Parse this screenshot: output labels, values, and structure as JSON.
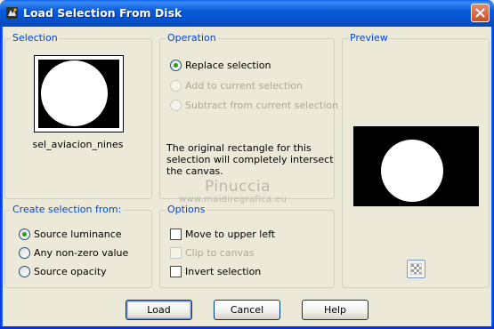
{
  "window": {
    "title": "Load Selection From Disk",
    "title_icon": "paint-shop-icon",
    "close_icon": "close-icon"
  },
  "selection": {
    "group_label": "Selection",
    "thumbnail_name": "sel_aviacion_nines"
  },
  "operation": {
    "group_label": "Operation",
    "options": [
      {
        "label": "Replace selection",
        "checked": true,
        "enabled": true
      },
      {
        "label": "Add to current selection",
        "checked": false,
        "enabled": false
      },
      {
        "label": "Subtract from current selection",
        "checked": false,
        "enabled": false
      }
    ],
    "info_text": "The original rectangle for this selection will completely intersect the canvas."
  },
  "preview": {
    "group_label": "Preview",
    "checker_icon": "transparency-checker-icon"
  },
  "create_from": {
    "group_label": "Create selection from:",
    "options": [
      {
        "label": "Source luminance",
        "checked": true
      },
      {
        "label": "Any non-zero value",
        "checked": false
      },
      {
        "label": "Source opacity",
        "checked": false
      }
    ]
  },
  "options": {
    "group_label": "Options",
    "items": [
      {
        "label": "Move to upper left",
        "checked": false,
        "enabled": true
      },
      {
        "label": "Clip to canvas",
        "checked": false,
        "enabled": false
      },
      {
        "label": "Invert selection",
        "checked": false,
        "enabled": true
      }
    ]
  },
  "watermark": {
    "name": "Pinuccia",
    "url": "www.maidiregrafica.eu"
  },
  "buttons": {
    "load": "Load",
    "cancel": "Cancel",
    "help": "Help"
  },
  "colors": {
    "group_label": "#0046d5",
    "titlebar": "#0a5ad8",
    "dialog_bg": "#ece9d8",
    "radio_dot": "#21a121"
  }
}
